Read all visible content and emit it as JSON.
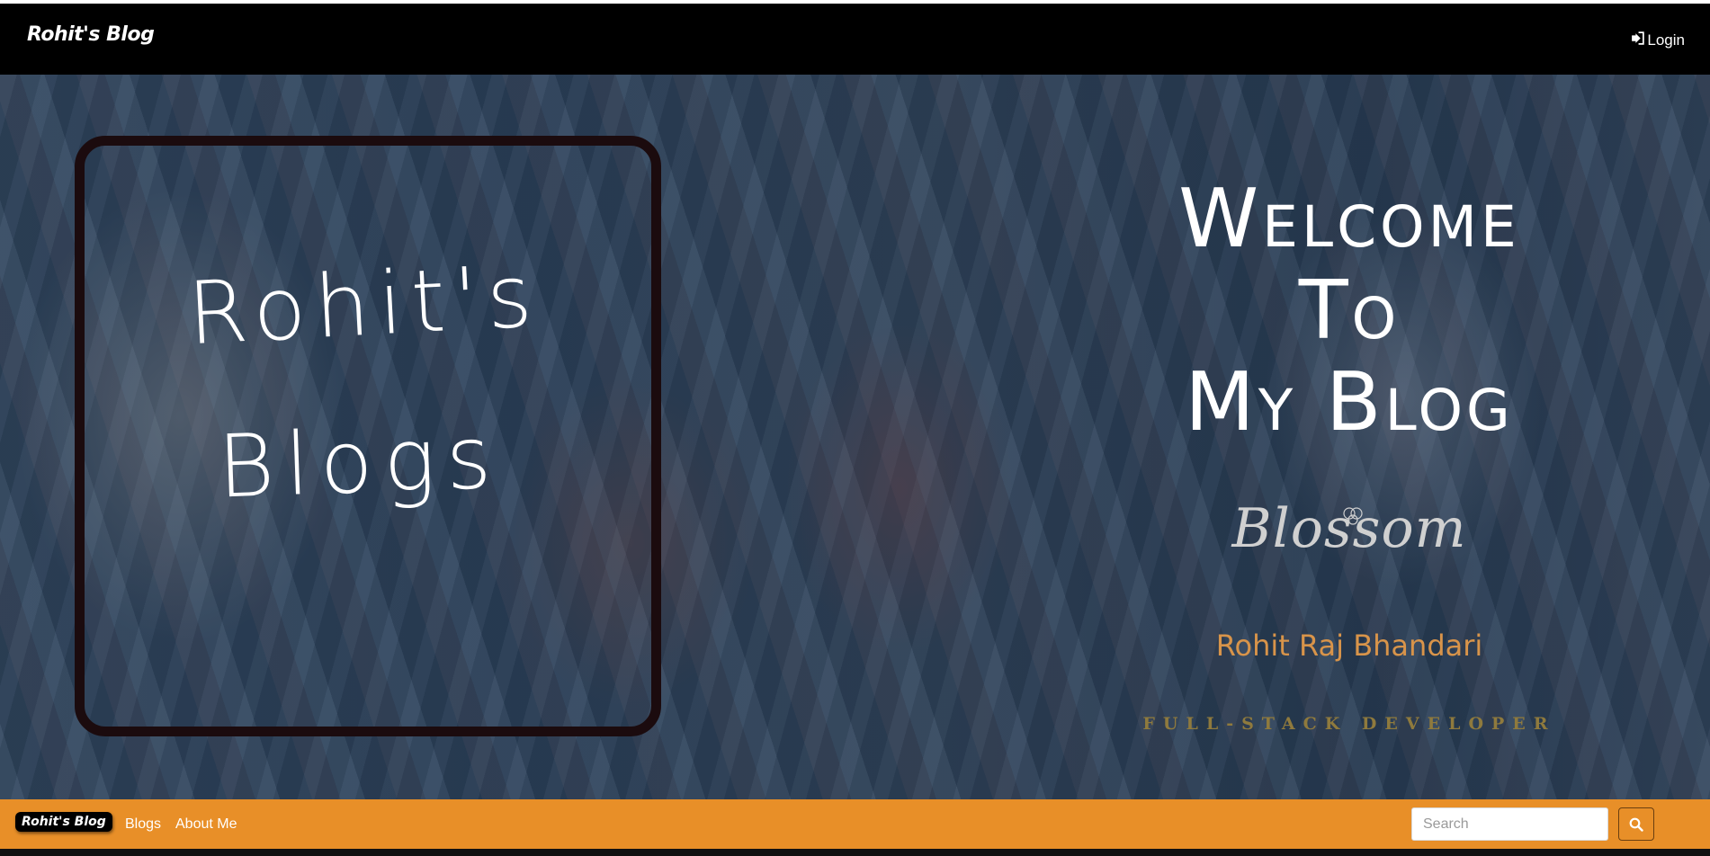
{
  "header": {
    "brand": "Rohit's Blog",
    "login_label": "Login"
  },
  "hero": {
    "frame_title_line1": "Rohit's",
    "frame_title_line2": "Blogs",
    "welcome_line1": "Welcome",
    "welcome_line2": "To",
    "welcome_line3": "My Blog",
    "signature": "Blossom",
    "author": "Rohit Raj Bhandari",
    "role": "FULL-STACK DEVELOPER"
  },
  "footer_nav": {
    "brand": "Rohit's Blog",
    "links": [
      "Blogs",
      "About Me"
    ],
    "search_placeholder": "Search"
  },
  "colors": {
    "accent": "#e88f28",
    "header_bg": "#000000",
    "author_text": "#d8944a"
  },
  "icons": {
    "login": "sign-in-icon",
    "search": "search-icon"
  }
}
